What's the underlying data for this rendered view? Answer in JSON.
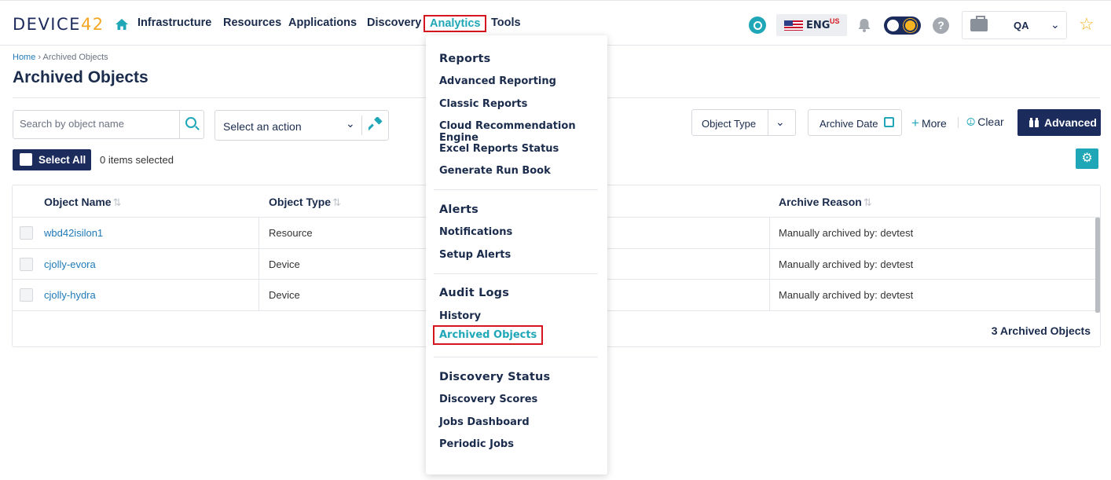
{
  "header": {
    "logo_text": "DEVICE",
    "logo_number": "42",
    "nav": [
      "Infrastructure",
      "Resources",
      "Applications",
      "Discovery",
      "Analytics",
      "Tools"
    ],
    "language": "ENG",
    "language_region": "US",
    "help": "?",
    "environment": "QA",
    "accent_color": "#1fa7b8",
    "brand_color": "#1a2b5c",
    "highlight_color": "#d6161f"
  },
  "breadcrumb": {
    "home": "Home",
    "separator": " › ",
    "current": "Archived Objects"
  },
  "page_title": "Archived Objects",
  "toolbar": {
    "search_placeholder": "Search by object name",
    "action_placeholder": "Select an action",
    "object_type": "Object Type",
    "archive_date": "Archive Date",
    "more": "More",
    "clear": "Clear",
    "advanced": "Advanced",
    "select_all": "Select All",
    "items_selected": "0 items selected"
  },
  "table": {
    "columns": [
      "Object Name",
      "Object Type",
      "Archive Reason"
    ],
    "rows": [
      {
        "name": "wbd42isilon1",
        "type": "Resource",
        "reason": "Manually archived by: devtest"
      },
      {
        "name": "cjolly-evora",
        "type": "Device",
        "reason": "Manually archived by: devtest"
      },
      {
        "name": "cjolly-hydra",
        "type": "Device",
        "reason": "Manually archived by: devtest"
      }
    ],
    "footer": "3 Archived Objects"
  },
  "analytics_menu": {
    "sections": [
      {
        "heading": "Reports",
        "items": [
          "Advanced Reporting",
          "Classic Reports",
          "Cloud Recommendation Engine",
          "Excel Reports Status",
          "Generate Run Book"
        ]
      },
      {
        "heading": "Alerts",
        "items": [
          "Notifications",
          "Setup Alerts"
        ]
      },
      {
        "heading": "Audit Logs",
        "items": [
          "History",
          "Archived Objects"
        ]
      },
      {
        "heading": "Discovery Status",
        "items": [
          "Discovery Scores",
          "Jobs Dashboard",
          "Periodic Jobs"
        ]
      }
    ],
    "active_item": "Archived Objects"
  }
}
